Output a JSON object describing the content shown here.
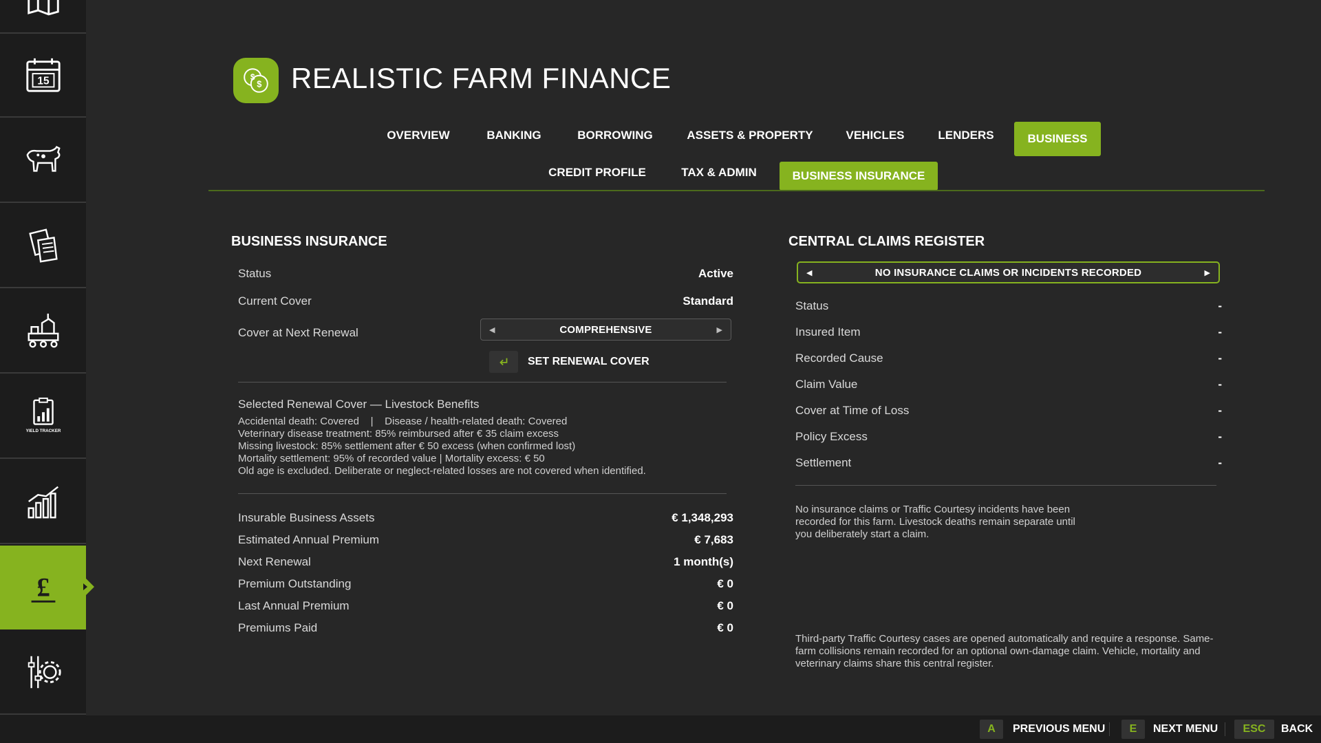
{
  "app": {
    "title": "REALISTIC FARM FINANCE",
    "brand_color": "#86b31f"
  },
  "sidebar": {
    "items": [
      {
        "icon": "map-icon"
      },
      {
        "icon": "calendar-icon",
        "text": "15"
      },
      {
        "icon": "cow-icon"
      },
      {
        "icon": "contracts-icon"
      },
      {
        "icon": "production-icon"
      },
      {
        "icon": "yield-tracker-icon",
        "text": "YIELD TRACKER"
      },
      {
        "icon": "stats-chart-icon"
      },
      {
        "icon": "pound-icon",
        "text": "£",
        "active": true
      },
      {
        "icon": "settings-icon"
      }
    ]
  },
  "tabs": {
    "main": [
      {
        "label": "OVERVIEW"
      },
      {
        "label": "BANKING"
      },
      {
        "label": "BORROWING"
      },
      {
        "label": "ASSETS & PROPERTY"
      },
      {
        "label": "VEHICLES"
      },
      {
        "label": "LENDERS"
      },
      {
        "label": "BUSINESS",
        "active": true
      }
    ],
    "sub": [
      {
        "label": "CREDIT PROFILE"
      },
      {
        "label": "TAX & ADMIN"
      },
      {
        "label": "BUSINESS INSURANCE",
        "active": true
      }
    ]
  },
  "insurance": {
    "title": "BUSINESS INSURANCE",
    "status_label": "Status",
    "status_value": "Active",
    "current_cover_label": "Current Cover",
    "current_cover_value": "Standard",
    "next_renewal_cover_label": "Cover at Next Renewal",
    "next_renewal_cover_value": "COMPREHENSIVE",
    "set_renewal_label": "SET RENEWAL COVER",
    "benefits_title": "Selected Renewal Cover — Livestock Benefits",
    "benefits": [
      "Accidental death: Covered    |    Disease / health-related death: Covered",
      "Veterinary disease treatment: 85% reimbursed after € 35 claim excess",
      "Missing livestock: 85% settlement after € 50 excess (when confirmed lost)",
      "Mortality settlement: 95% of recorded value | Mortality excess: € 50",
      "Old age is excluded. Deliberate or neglect-related losses are not covered when identified."
    ],
    "summary": [
      {
        "label": "Insurable Business Assets",
        "value": "€ 1,348,293"
      },
      {
        "label": "Estimated Annual Premium",
        "value": "€ 7,683"
      },
      {
        "label": "Next Renewal",
        "value": "1 month(s)"
      },
      {
        "label": "Premium Outstanding",
        "value": "€ 0"
      },
      {
        "label": "Last Annual Premium",
        "value": "€ 0"
      },
      {
        "label": "Premiums Paid",
        "value": "€ 0"
      }
    ]
  },
  "claims": {
    "title": "CENTRAL CLAIMS REGISTER",
    "selector_value": "NO INSURANCE CLAIMS OR INCIDENTS RECORDED",
    "rows": [
      {
        "label": "Status",
        "value": "-"
      },
      {
        "label": "Insured Item",
        "value": "-"
      },
      {
        "label": "Recorded Cause",
        "value": "-"
      },
      {
        "label": "Claim Value",
        "value": "-"
      },
      {
        "label": "Cover at Time of Loss",
        "value": "-"
      },
      {
        "label": "Policy Excess",
        "value": "-"
      },
      {
        "label": "Settlement",
        "value": "-"
      }
    ],
    "note": "No insurance claims or Traffic Courtesy incidents have been recorded for this farm. Livestock deaths remain separate until you deliberately start a claim.",
    "footnote": "Third-party Traffic Courtesy cases are opened automatically and require a response. Same-farm collisions remain recorded for an optional own-damage claim. Vehicle, mortality and veterinary claims share this central register."
  },
  "footer": {
    "prev_key": "A",
    "prev_label": "PREVIOUS MENU",
    "next_key": "E",
    "next_label": "NEXT MENU",
    "back_key": "ESC",
    "back_label": "BACK"
  }
}
